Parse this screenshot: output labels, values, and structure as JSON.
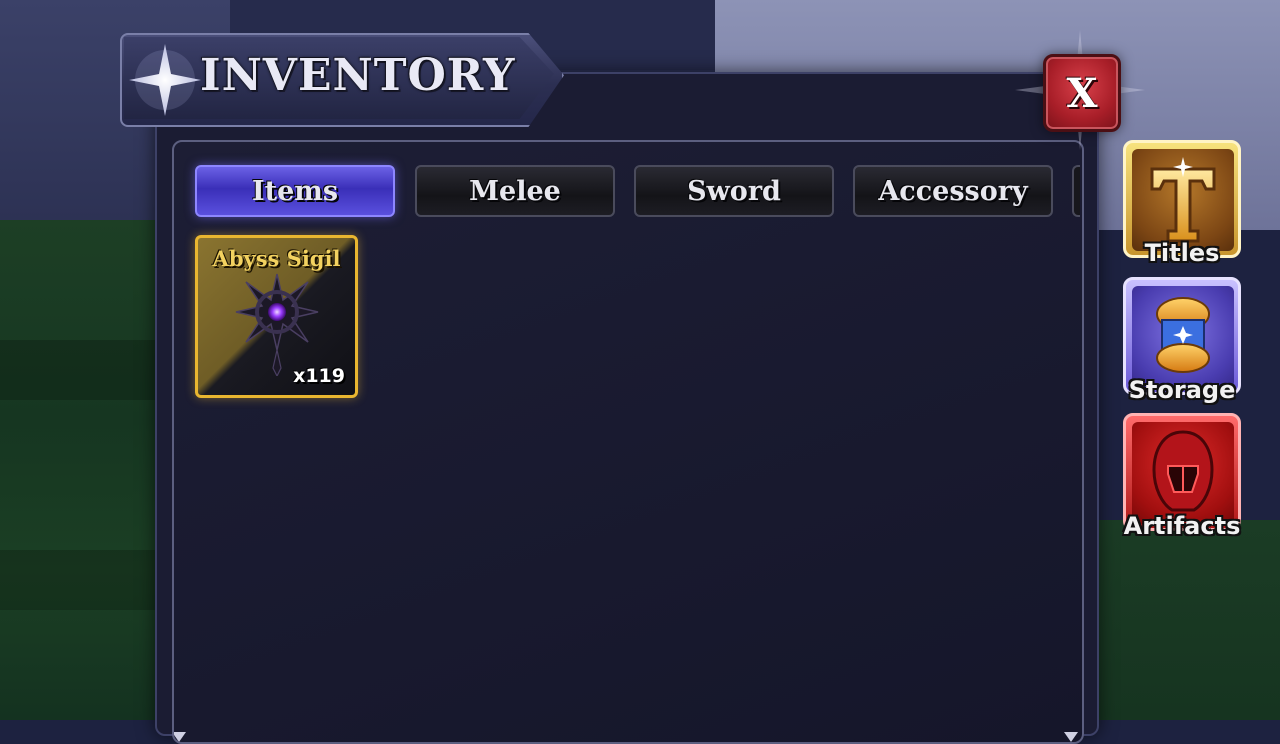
{
  "window": {
    "title": "INVENTORY",
    "close_label": "X"
  },
  "tabs": [
    {
      "label": "Items",
      "active": true
    },
    {
      "label": "Melee",
      "active": false
    },
    {
      "label": "Sword",
      "active": false
    },
    {
      "label": "Accessory",
      "active": false
    }
  ],
  "items": [
    {
      "name": "Abyss Sigil",
      "quantity": "x119",
      "rarity_color": "#e9b630",
      "icon": "abyss-sigil-icon"
    }
  ],
  "side_menu": [
    {
      "label": "Titles",
      "icon": "titles-icon"
    },
    {
      "label": "Storage",
      "icon": "storage-icon"
    },
    {
      "label": "Artifacts",
      "icon": "artifacts-icon"
    }
  ],
  "colors": {
    "active_tab": "#5a50de",
    "close_button": "#c0303a",
    "panel": "#1b1c33"
  }
}
